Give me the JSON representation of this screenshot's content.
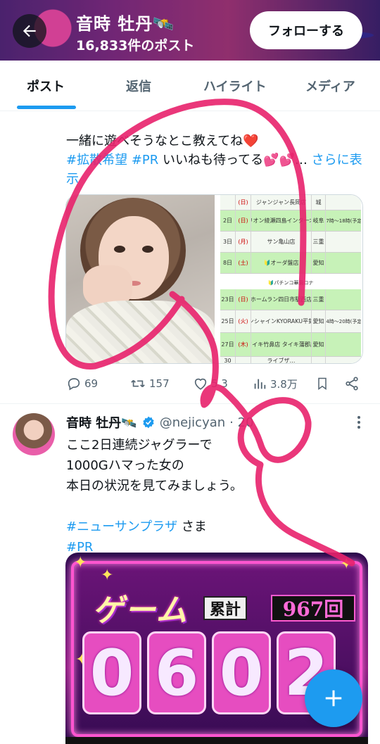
{
  "header": {
    "title": "音時 牡丹🛰️",
    "post_count": "16,833件のポスト",
    "follow_label": "フォローする"
  },
  "tabs": [
    {
      "label": "ポスト",
      "active": true
    },
    {
      "label": "返信",
      "active": false
    },
    {
      "label": "ハイライト",
      "active": false
    },
    {
      "label": "メディア",
      "active": false
    }
  ],
  "post1": {
    "text_line1": "一緒に遊べそうなとこ教えてね❤️",
    "hashtag1": "#拡散希望",
    "hashtag2": "#PR",
    "text_line2_rest": " いいねも待ってる💕💕…",
    "more_label": " さらに表示",
    "table": {
      "banner": "🔰パチンコ華園ロナ",
      "rows": [
        {
          "day": "",
          "dow": "(日)",
          "store": "ジャンジャン長岡店",
          "pref": "城",
          "time": ""
        },
        {
          "day": "2日",
          "dow": "(日)",
          "store": "マリオン綾瀬四島インタ一北店",
          "pref": "岐阜",
          "time": "17時～18時(予定)"
        },
        {
          "day": "3日",
          "dow": "(月)",
          "store": "サン亀山店",
          "pref": "三重",
          "time": ""
        },
        {
          "day": "8日",
          "dow": "(土)",
          "store": "🔰オーダ盤店",
          "pref": "愛知",
          "time": ""
        },
        {
          "day": "23日",
          "dow": "(日)",
          "store": "ホームラン四日市駅西店",
          "pref": "三重",
          "time": ""
        },
        {
          "day": "25日",
          "dow": "(火)",
          "store": "サンシャインKYORAKU平針店",
          "pref": "愛知",
          "time": "14時～20時(予定)"
        },
        {
          "day": "27日",
          "dow": "(木)",
          "store": "タイキ竹鼻店 タイキ蒲郡店",
          "pref": "愛知",
          "time": ""
        },
        {
          "day": "30",
          "dow": "",
          "store": "ライブザ…",
          "pref": "",
          "time": ""
        }
      ]
    },
    "stats": {
      "replies": "69",
      "reposts": "157",
      "likes": "5 3",
      "views": "3.8万"
    }
  },
  "post2": {
    "name": "音時 牡丹🛰️",
    "handle": "@nejicyan",
    "time": "· 20",
    "lines": [
      "ここ2日連続ジャグラーで",
      "1000Gハマった女の",
      "本日の状況を見てみましょう。"
    ],
    "hashtag1": "#ニューサンプラザ",
    "hashtag1_suffix": " さま",
    "hashtag2": "#PR",
    "media": {
      "game_label": "ゲーム",
      "total_label": "累計",
      "total_value": "967回",
      "digits": [
        "0",
        "6",
        "0",
        "2"
      ]
    }
  },
  "colors": {
    "accent": "#1d9bf0",
    "text": "#0f1419",
    "muted": "#536471",
    "scribble": "#e8216b"
  }
}
